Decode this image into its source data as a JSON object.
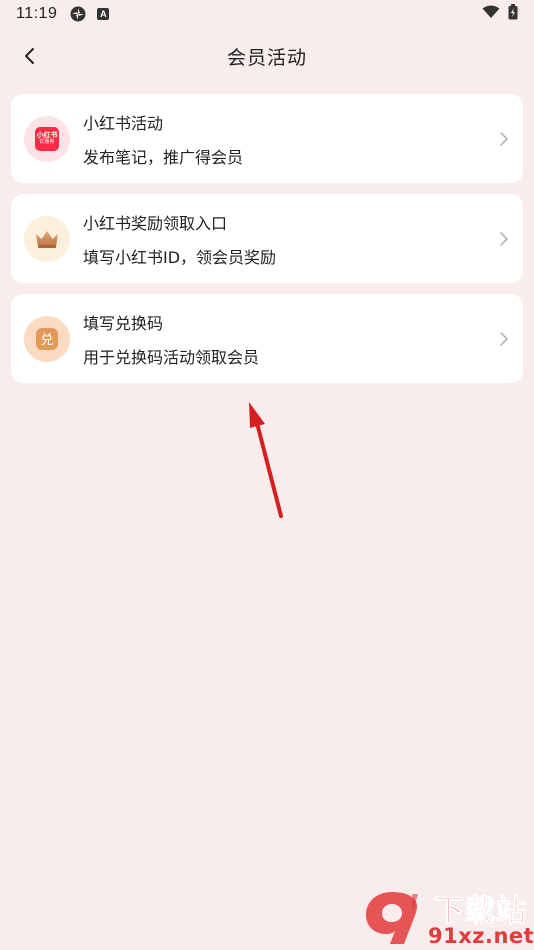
{
  "status_bar": {
    "time": "11:19",
    "a_badge": "A"
  },
  "header": {
    "title": "会员活动"
  },
  "items": [
    {
      "title": "小红书活动",
      "subtitle": "发布笔记，推广得会员",
      "icon": "xiaohongshu-logo-icon",
      "logo_text": "小红书",
      "logo_small": "优惠券"
    },
    {
      "title": "小红书奖励领取入口",
      "subtitle": "填写小红书ID，领会员奖励",
      "icon": "crown-icon"
    },
    {
      "title": "填写兑换码",
      "subtitle": "用于兑换码活动领取会员",
      "icon": "redeem-icon",
      "badge_text": "兑"
    }
  ],
  "watermark": {
    "top_text": "下载站",
    "bottom_text": "91xz.net"
  },
  "colors": {
    "background": "#f8eced",
    "card": "#ffffff",
    "arrow": "#d42020",
    "xhs_red": "#ff2a45",
    "redeem_orange": "#e29a58"
  }
}
